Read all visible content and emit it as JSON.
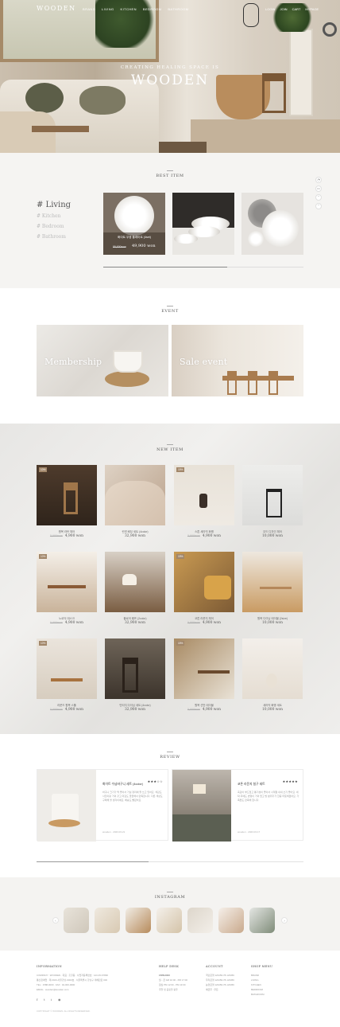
{
  "header": {
    "logo": "WOODEN",
    "menu": [
      "BRAND",
      "LIVING",
      "KITCHEN",
      "BEDROOM",
      "BATHROOM"
    ],
    "util": [
      "LOGIN",
      "JOIN",
      "CART",
      "MYPAGE"
    ]
  },
  "hero": {
    "subtitle": "CREATING HEALING SPACE IS",
    "title": "WOODEN"
  },
  "best": {
    "title": "BEST ITEM",
    "categories": [
      "# Living",
      "# Kitchen",
      "# Bedroom",
      "# Bathroom"
    ],
    "product": {
      "name": "화이트 무광 플레이트 (4set)",
      "old_price": "55,000won",
      "price": "49,900 won"
    },
    "progress": 0.62
  },
  "event": {
    "title": "EVENT",
    "cards": [
      "Membership",
      "Sale event"
    ]
  },
  "new_item": {
    "title": "NEW ITEM",
    "items": [
      {
        "badge": "10%",
        "name": "원목 라탄 체어",
        "old": "5,000won",
        "price": "4,900 won"
      },
      {
        "badge": "",
        "name": "린넨 베딩 세트 (4color)",
        "old": "",
        "price": "32,900 won"
      },
      {
        "badge": "15%",
        "name": "스톤 세라믹 화병",
        "old": "5,000won",
        "price": "4,900 won"
      },
      {
        "badge": "",
        "name": "우드 디자인 체어",
        "old": "",
        "price": "10,000 won"
      },
      {
        "badge": "10%",
        "name": "노르딕 데스크",
        "old": "5,000won",
        "price": "4,900 won"
      },
      {
        "badge": "",
        "name": "플로어 램프 (2color)",
        "old": "",
        "price": "32,900 won"
      },
      {
        "badge": "15%",
        "name": "코튼 라운지 체어",
        "old": "5,000won",
        "price": "4,900 won"
      },
      {
        "badge": "",
        "name": "원목 다이닝 테이블 (2size)",
        "old": "",
        "price": "10,000 won"
      },
      {
        "badge": "10%",
        "name": "라운드 원목 스툴",
        "old": "5,000won",
        "price": "4,900 won"
      },
      {
        "badge": "",
        "name": "빈티지 다이닝 세트 (4color)",
        "old": "",
        "price": "32,900 won"
      },
      {
        "badge": "15%",
        "name": "원목 선반 테이블",
        "old": "5,000won",
        "price": "4,900 won"
      },
      {
        "badge": "",
        "name": "세라믹 화병 세트",
        "old": "",
        "price": "10,000 won"
      }
    ]
  },
  "review": {
    "title": "REVIEW",
    "cards": [
      {
        "title": "화이트 수납바구니 세트 (4color)",
        "stars": "★★★☆☆",
        "body": "바구니 크기가 딱 좋아서 거실 정리에 잘 쓰고 있어요. 색감도 사진이랑 거의 같고 마감도 깔끔해서 만족합니다. 다른 색상도 구매해 볼 생각이에요. 배송도 빨랐어요.",
        "meta": "wooden  ·  2023.03.21"
      },
      {
        "title": "코튼 라운지 침구 세트",
        "stars": "★★★★★",
        "body": "촉감이 부드럽고 통기성이 좋아서 사계절 내내 쓰기 좋아요. 세탁 후에도 변형이 거의 없고 방 분위기가 한층 따뜻해졌어요. 가족들도 만족해 합니다.",
        "meta": "wooden  ·  2023.03.17"
      }
    ],
    "progress": 0.42
  },
  "instagram": {
    "title": "INSTAGRAM",
    "prev": "‹",
    "next": "›"
  },
  "footer": {
    "info_title": "INFORMATION",
    "info_lines": [
      "COMPANY : WOODEN  ·  대표 : 홍길동  ·  사업자등록번호 : 123-45-67890",
      "통신판매업 : 제 2023-서울강남-0000호  ·  서울특별시 강남구 테헤란로 000",
      "TEL : 1588-0000  ·  FAX : 02-000-0000",
      "EMAIL : wooden@wooden.com"
    ],
    "sns": [
      "f",
      "t",
      "i",
      "◉"
    ],
    "copyright": "COPYRIGHT © WOODEN. ALL RIGHTS RESERVED.",
    "help_title": "HELP DESK",
    "help_lines": [
      "1588-0000",
      "월 - 금 AM 10:00 - PM 17:00",
      "점심 PM 12:00 - PM 13:00",
      "주말 및 공휴일 휴무"
    ],
    "account_title": "ACCOUNT",
    "account_lines": [
      "국민은행 123456-78-123456",
      "우리은행 123456-78-123456",
      "농협은행 123456-78-123456",
      "예금주 : 우든"
    ],
    "shop_title": "SHOP MENU",
    "shop_lines": [
      "BRAND",
      "LIVING",
      "KITCHEN",
      "BEDROOM",
      "BATHROOM"
    ]
  }
}
